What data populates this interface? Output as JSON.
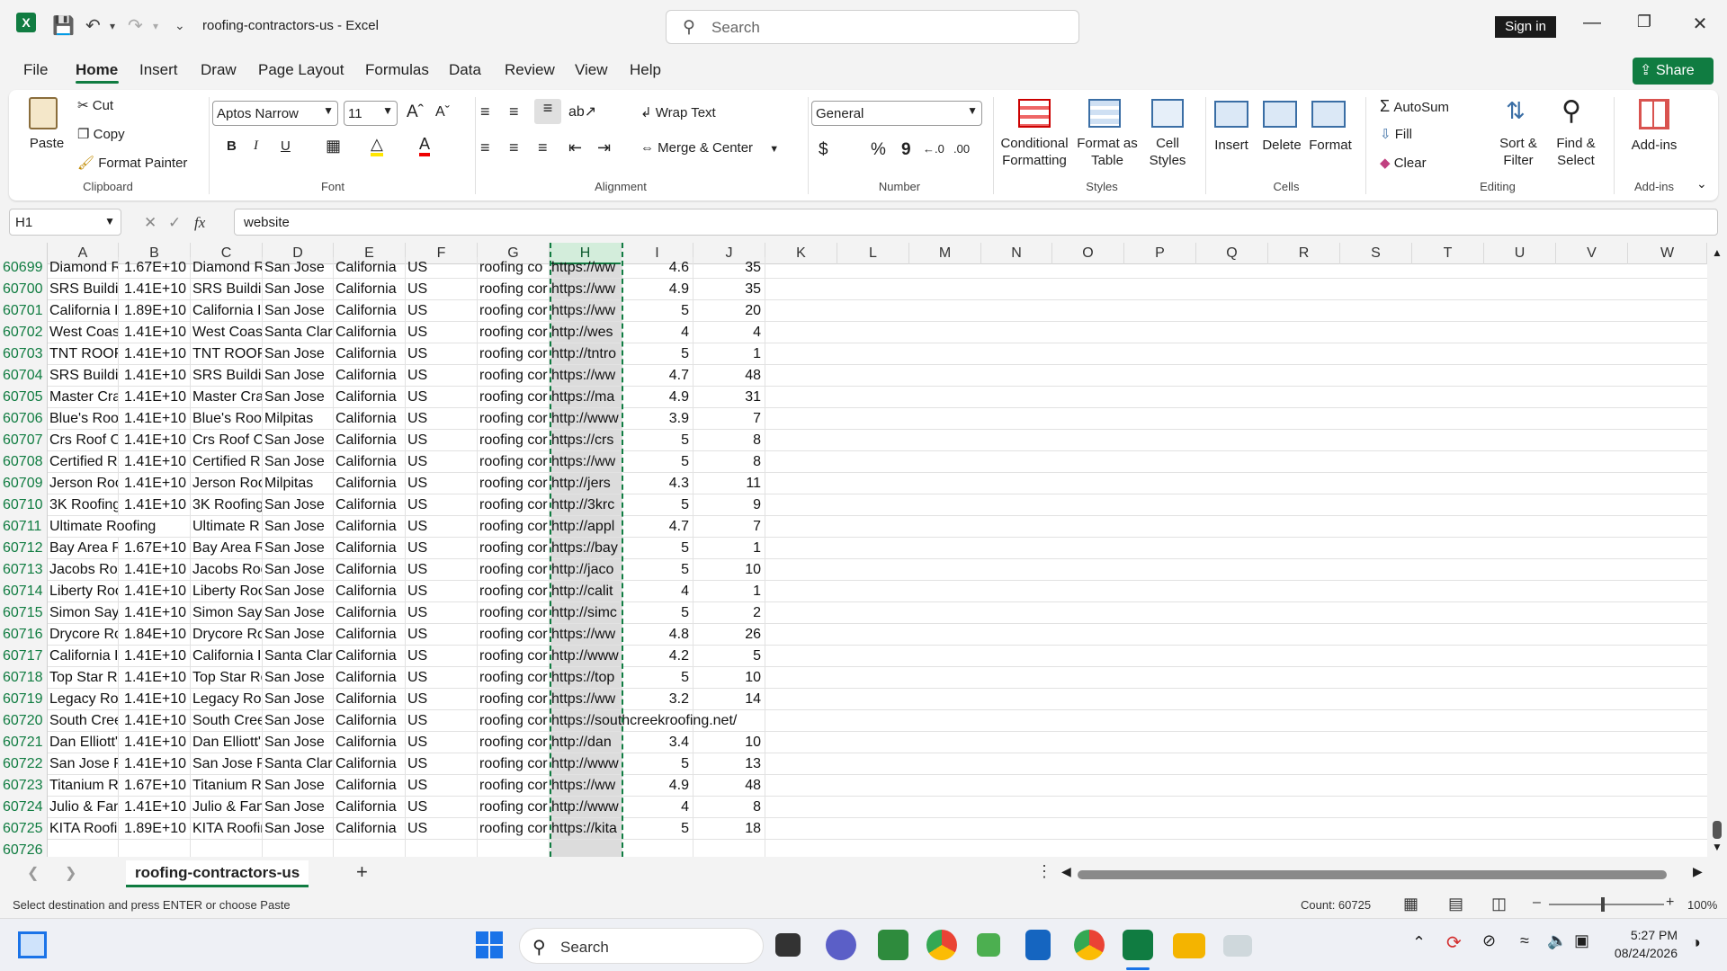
{
  "titlebar": {
    "doc_title": "roofing-contractors-us  -  Excel",
    "search_placeholder": "Search",
    "signin": "Sign in"
  },
  "menu": {
    "tabs": [
      "File",
      "Home",
      "Insert",
      "Draw",
      "Page Layout",
      "Formulas",
      "Data",
      "Review",
      "View",
      "Help"
    ],
    "share": "Share"
  },
  "ribbon": {
    "clipboard": {
      "paste": "Paste",
      "cut": "Cut",
      "copy": "Copy",
      "format_painter": "Format Painter",
      "label": "Clipboard"
    },
    "font": {
      "name": "Aptos Narrow",
      "size": "11",
      "bold": "B",
      "italic": "I",
      "underline": "U",
      "label": "Font"
    },
    "alignment": {
      "wrap_text": "Wrap Text",
      "merge_center": "Merge & Center",
      "label": "Alignment"
    },
    "number": {
      "format": "General",
      "currency": "$",
      "percent": "%",
      "comma": "9",
      "label": "Number"
    },
    "styles": {
      "conditional": "Conditional\nFormatting",
      "format_table": "Format as\nTable",
      "cell_styles": "Cell\nStyles",
      "label": "Styles"
    },
    "cells": {
      "insert": "Insert",
      "delete": "Delete",
      "format": "Format",
      "label": "Cells"
    },
    "editing": {
      "autosum": "AutoSum",
      "fill": "Fill",
      "clear": "Clear",
      "sort_filter": "Sort &\nFilter",
      "find_select": "Find &\nSelect",
      "label": "Editing"
    },
    "addins": {
      "addins": "Add-ins",
      "label": "Add-ins"
    }
  },
  "formula_bar": {
    "name_box": "H1",
    "fx": "fx",
    "value": "website"
  },
  "grid": {
    "columns": [
      "A",
      "B",
      "C",
      "D",
      "E",
      "F",
      "G",
      "H",
      "I",
      "J",
      "K",
      "L",
      "M",
      "N",
      "O",
      "P",
      "Q",
      "R",
      "S",
      "T",
      "U",
      "V",
      "W"
    ],
    "partial_row": [
      "60699",
      "Diamond R",
      "1.67E+10",
      "Diamond R",
      "San Jose",
      "California",
      "US",
      "roofing co",
      "https://ww",
      "4.6",
      "35"
    ],
    "rows": [
      [
        "60700",
        "SRS Buildir",
        "1.41E+10",
        "SRS Buildir",
        "San Jose",
        "California",
        "US",
        "roofing cor",
        "https://ww",
        "4.9",
        "35"
      ],
      [
        "60701",
        "California I",
        "1.89E+10",
        "California I",
        "San Jose",
        "California",
        "US",
        "roofing cor",
        "https://ww",
        "5",
        "20"
      ],
      [
        "60702",
        "West Coas",
        "1.41E+10",
        "West Coas",
        "Santa Clar",
        "California",
        "US",
        "roofing cor",
        "http://wes",
        "4",
        "4"
      ],
      [
        "60703",
        "TNT ROOFI",
        "1.41E+10",
        "TNT ROOFI",
        "San Jose",
        "California",
        "US",
        "roofing cor",
        "http://tntro",
        "5",
        "1"
      ],
      [
        "60704",
        "SRS Buildir",
        "1.41E+10",
        "SRS Buildir",
        "San Jose",
        "California",
        "US",
        "roofing cor",
        "https://ww",
        "4.7",
        "48"
      ],
      [
        "60705",
        "Master Cra",
        "1.41E+10",
        "Master Cra",
        "San Jose",
        "California",
        "US",
        "roofing cor",
        "https://ma",
        "4.9",
        "31"
      ],
      [
        "60706",
        "Blue's Roo",
        "1.41E+10",
        "Blue's Roo",
        "Milpitas",
        "California",
        "US",
        "roofing cor",
        "http://www",
        "3.9",
        "7"
      ],
      [
        "60707",
        "Crs Roof C",
        "1.41E+10",
        "Crs Roof C",
        "San Jose",
        "California",
        "US",
        "roofing cor",
        "https://crs",
        "5",
        "8"
      ],
      [
        "60708",
        "Certified R",
        "1.41E+10",
        "Certified R",
        "San Jose",
        "California",
        "US",
        "roofing cor",
        "https://ww",
        "5",
        "8"
      ],
      [
        "60709",
        "Jerson Roo",
        "1.41E+10",
        "Jerson Roo",
        "Milpitas",
        "California",
        "US",
        "roofing cor",
        "http://jers",
        "4.3",
        "11"
      ],
      [
        "60710",
        "3K Roofing",
        "1.41E+10",
        "3K Roofing",
        "San Jose",
        "California",
        "US",
        "roofing cor",
        "http://3krc",
        "5",
        "9"
      ],
      [
        "60711",
        "Ultimate Roofing",
        "",
        "Ultimate R",
        "San Jose",
        "California",
        "US",
        "roofing cor",
        "http://appl",
        "4.7",
        "7"
      ],
      [
        "60712",
        "Bay Area R",
        "1.67E+10",
        "Bay Area R",
        "San Jose",
        "California",
        "US",
        "roofing cor",
        "https://bay",
        "5",
        "1"
      ],
      [
        "60713",
        "Jacobs Roo",
        "1.41E+10",
        "Jacobs Roo",
        "San Jose",
        "California",
        "US",
        "roofing cor",
        "http://jaco",
        "5",
        "10"
      ],
      [
        "60714",
        "Liberty Roo",
        "1.41E+10",
        "Liberty Roo",
        "San Jose",
        "California",
        "US",
        "roofing cor",
        "http://calit",
        "4",
        "1"
      ],
      [
        "60715",
        "Simon Says",
        "1.41E+10",
        "Simon Says",
        "San Jose",
        "California",
        "US",
        "roofing cor",
        "http://simc",
        "5",
        "2"
      ],
      [
        "60716",
        "Drycore Ro",
        "1.84E+10",
        "Drycore Ro",
        "San Jose",
        "California",
        "US",
        "roofing cor",
        "https://ww",
        "4.8",
        "26"
      ],
      [
        "60717",
        "California I",
        "1.41E+10",
        "California I",
        "Santa Clar",
        "California",
        "US",
        "roofing cor",
        "http://www",
        "4.2",
        "5"
      ],
      [
        "60718",
        "Top Star Ro",
        "1.41E+10",
        "Top Star Ro",
        "San Jose",
        "California",
        "US",
        "roofing cor",
        "https://top",
        "5",
        "10"
      ],
      [
        "60719",
        "Legacy Roo",
        "1.41E+10",
        "Legacy Roo",
        "San Jose",
        "California",
        "US",
        "roofing cor",
        "https://ww",
        "3.2",
        "14"
      ],
      [
        "60720",
        "South Cree",
        "1.41E+10",
        "South Cree",
        "San Jose",
        "California",
        "US",
        "roofing cor",
        "https://southcreekroofing.net/",
        "",
        ""
      ],
      [
        "60721",
        "Dan Elliott'",
        "1.41E+10",
        "Dan Elliott'",
        "San Jose",
        "California",
        "US",
        "roofing cor",
        "http://dan",
        "3.4",
        "10"
      ],
      [
        "60722",
        "San Jose R",
        "1.41E+10",
        "San Jose R",
        "Santa Clar",
        "California",
        "US",
        "roofing cor",
        "http://www",
        "5",
        "13"
      ],
      [
        "60723",
        "Titanium R",
        "1.67E+10",
        "Titanium R",
        "San Jose",
        "California",
        "US",
        "roofing cor",
        "https://ww",
        "4.9",
        "48"
      ],
      [
        "60724",
        "Julio & Fan",
        "1.41E+10",
        "Julio & Fan",
        "San Jose",
        "California",
        "US",
        "roofing cor",
        "http://www",
        "4",
        "8"
      ],
      [
        "60725",
        "KITA Roofir",
        "1.89E+10",
        "KITA Roofir",
        "San Jose",
        "California",
        "US",
        "roofing cor",
        "https://kita",
        "5",
        "18"
      ],
      [
        "60726",
        "",
        "",
        "",
        "",
        "",
        "",
        "",
        "",
        "",
        ""
      ]
    ]
  },
  "sheets": {
    "active": "roofing-contractors-us",
    "add": "+"
  },
  "status": {
    "message": "Select destination and press ENTER or choose Paste",
    "count": "Count: 60725",
    "zoom": "100%"
  },
  "taskbar": {
    "search": "Search",
    "time": "5:27 PM",
    "date": "08/24/2026"
  },
  "colors": {
    "accent": "#107c41",
    "selection_shade": "#dcdcdc"
  }
}
